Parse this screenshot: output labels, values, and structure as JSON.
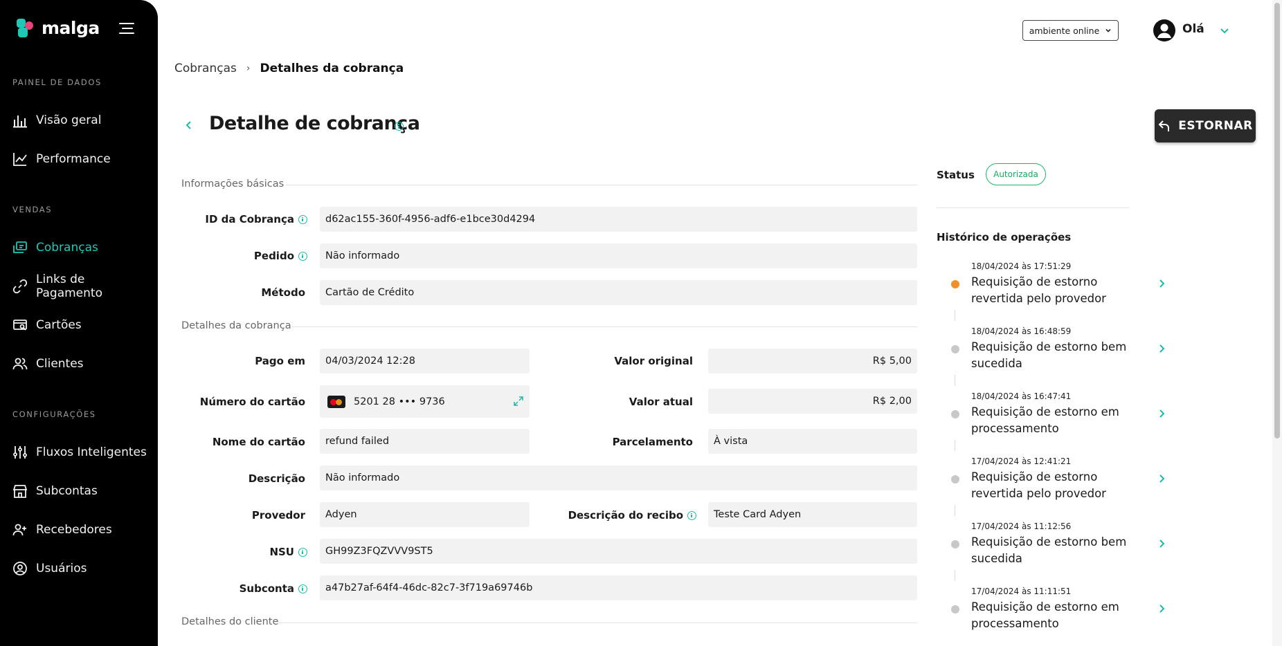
{
  "brand": {
    "name": "malga"
  },
  "sidebar": {
    "sections": [
      {
        "title": "PAINEL DE DADOS"
      },
      {
        "title": "VENDAS"
      },
      {
        "title": "CONFIGURAÇÕES"
      }
    ],
    "items": [
      {
        "label": "Visão geral",
        "icon": "bar-chart-icon"
      },
      {
        "label": "Performance",
        "icon": "line-chart-icon"
      },
      {
        "label": "Cobranças",
        "icon": "charges-icon",
        "active": true
      },
      {
        "label": "Links de Pagamento",
        "icon": "link-icon"
      },
      {
        "label": "Cartões",
        "icon": "card-search-icon"
      },
      {
        "label": "Clientes",
        "icon": "users-icon"
      },
      {
        "label": "Fluxos Inteligentes",
        "icon": "sliders-icon"
      },
      {
        "label": "Subcontas",
        "icon": "store-icon"
      },
      {
        "label": "Recebedores",
        "icon": "user-add-icon"
      },
      {
        "label": "Usuários",
        "icon": "user-circle-icon"
      }
    ]
  },
  "topbar": {
    "environment": "ambiente online",
    "greeting": "Olá"
  },
  "breadcrumb": {
    "parent": "Cobranças",
    "current": "Detalhes da cobrança"
  },
  "page": {
    "title": "Detalhe de cobrança",
    "refund_label": "ESTORNAR"
  },
  "sections": {
    "basic": "Informações básicas",
    "charge": "Detalhes da cobrança",
    "customer": "Detalhes do cliente"
  },
  "fields": {
    "charge_id": {
      "label": "ID da Cobrança",
      "value": "d62ac155-360f-4956-adf6-e1bce30d4294"
    },
    "order": {
      "label": "Pedido",
      "value": "Não informado"
    },
    "method": {
      "label": "Método",
      "value": "Cartão de Crédito"
    },
    "paid_at": {
      "label": "Pago em",
      "value": "04/03/2024 12:28"
    },
    "original_value": {
      "label": "Valor original",
      "value": "R$ 5,00"
    },
    "card_number": {
      "label": "Número do cartão",
      "value": "5201 28 ••• 9736"
    },
    "current_value": {
      "label": "Valor atual",
      "value": "R$ 2,00"
    },
    "card_name": {
      "label": "Nome do cartão",
      "value": "refund failed"
    },
    "installments": {
      "label": "Parcelamento",
      "value": "À vista"
    },
    "description": {
      "label": "Descrição",
      "value": "Não informado"
    },
    "provider": {
      "label": "Provedor",
      "value": "Adyen"
    },
    "receipt_description": {
      "label": "Descrição do recibo",
      "value": "Teste Card Adyen"
    },
    "nsu": {
      "label": "NSU",
      "value": "GH99Z3FQZVVV9ST5"
    },
    "subaccount": {
      "label": "Subconta",
      "value": "a47b27af-64f4-46dc-82c7-3f719a69746b"
    }
  },
  "status": {
    "label": "Status",
    "value": "Autorizada",
    "color": "#1fa55f"
  },
  "history": {
    "title": "Histórico de operações",
    "items": [
      {
        "date": "18/04/2024 às 17:51:29",
        "text": "Requisição de estorno revertida pelo provedor",
        "dot": "#f0902a"
      },
      {
        "date": "18/04/2024 às 16:48:59",
        "text": "Requisição de estorno bem sucedida",
        "dot": "#c8c8c8"
      },
      {
        "date": "18/04/2024 às 16:47:41",
        "text": "Requisição de estorno em processamento",
        "dot": "#c8c8c8"
      },
      {
        "date": "17/04/2024 às 12:41:21",
        "text": "Requisição de estorno revertida pelo provedor",
        "dot": "#c8c8c8"
      },
      {
        "date": "17/04/2024 às 11:12:56",
        "text": "Requisição de estorno bem sucedida",
        "dot": "#c8c8c8"
      },
      {
        "date": "17/04/2024 às 11:11:51",
        "text": "Requisição de estorno em processamento",
        "dot": "#c8c8c8"
      }
    ]
  },
  "colors": {
    "accent": "#1fc8b4",
    "sidebar_bg": "#000000",
    "field_bg": "#f2f2f2"
  }
}
